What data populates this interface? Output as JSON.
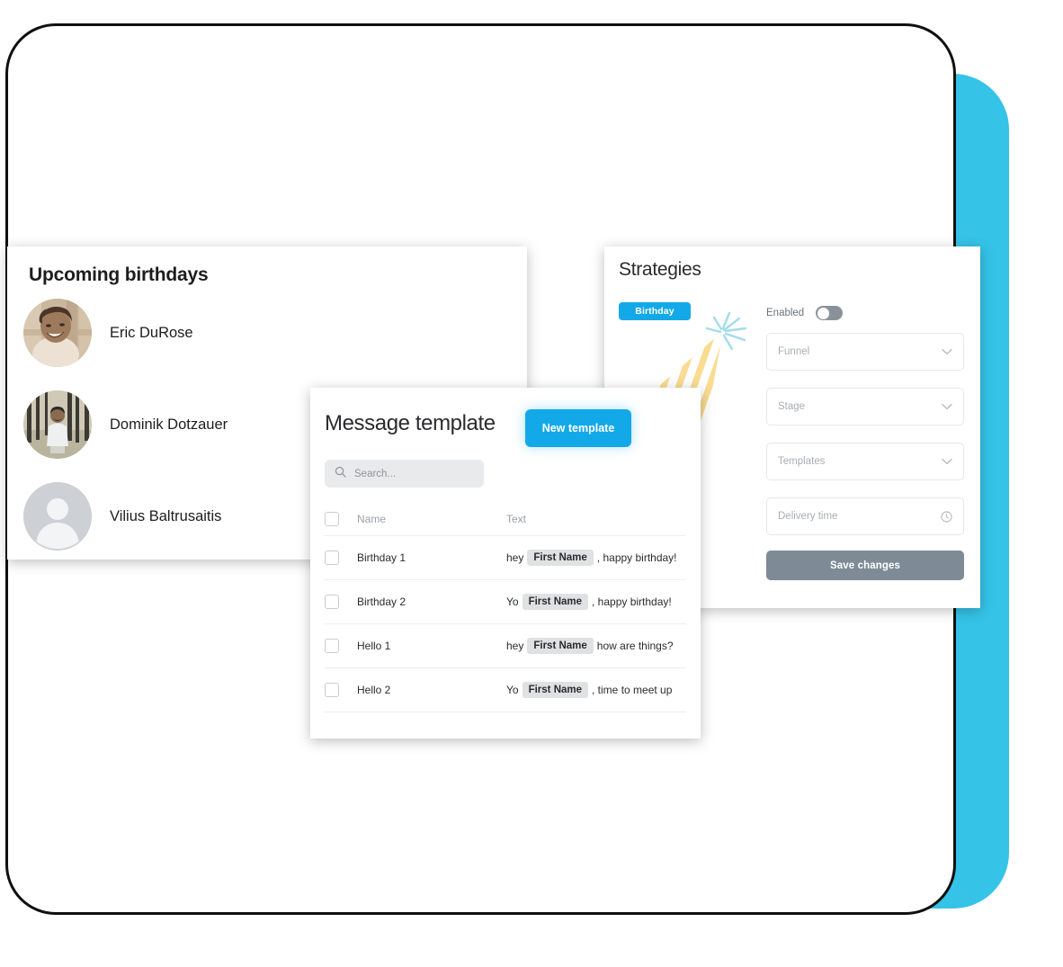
{
  "theme": {
    "accent_blue": "#13a9e8",
    "background_cyan": "#35c3e8",
    "frame_outline": "#101010",
    "save_button_grey": "#7e8b96",
    "token_grey": "#dfe1e3",
    "hat_yellow": "#f8d880",
    "sparkle_blue": "#9fdced"
  },
  "birthdays_panel": {
    "title": "Upcoming birthdays",
    "people": [
      {
        "name": "Eric DuRose",
        "avatar": "photo-portrait-sepia"
      },
      {
        "name": "Dominik Dotzauer",
        "avatar": "photo-portrait-forest"
      },
      {
        "name": "Vilius Baltrusaitis",
        "avatar": "person-placeholder-icon"
      }
    ]
  },
  "strategies_panel": {
    "title": "Strategies",
    "chip": "Birthday",
    "enabled": {
      "label": "Enabled",
      "state": "off"
    },
    "fields": [
      {
        "name": "funnel",
        "placeholder": "Funnel",
        "icon": "chevron-down-icon"
      },
      {
        "name": "stage",
        "placeholder": "Stage",
        "icon": "chevron-down-icon"
      },
      {
        "name": "templates",
        "placeholder": "Templates",
        "icon": "chevron-down-icon"
      },
      {
        "name": "delivery-time",
        "placeholder": "Delivery time",
        "icon": "clock-icon"
      }
    ],
    "save_label": "Save changes"
  },
  "template_panel": {
    "title": "Message template",
    "new_button": "New template",
    "search": {
      "placeholder": "Search...",
      "value": "",
      "icon": "search-icon"
    },
    "columns": {
      "name": "Name",
      "text": "Text"
    },
    "rows": [
      {
        "name": "Birthday 1",
        "prefix": "hey",
        "token": "First Name",
        "suffix": ", happy birthday!",
        "checked": false
      },
      {
        "name": "Birthday 2",
        "prefix": "Yo",
        "token": "First Name",
        "suffix": ", happy birthday!",
        "checked": false
      },
      {
        "name": "Hello 1",
        "prefix": "hey",
        "token": "First Name",
        "suffix": "how are things?",
        "checked": false
      },
      {
        "name": "Hello 2",
        "prefix": "Yo",
        "token": "First Name",
        "suffix": ", time to meet up",
        "checked": false
      }
    ]
  },
  "decoration": {
    "party_hat": "party-hat-illustration"
  }
}
